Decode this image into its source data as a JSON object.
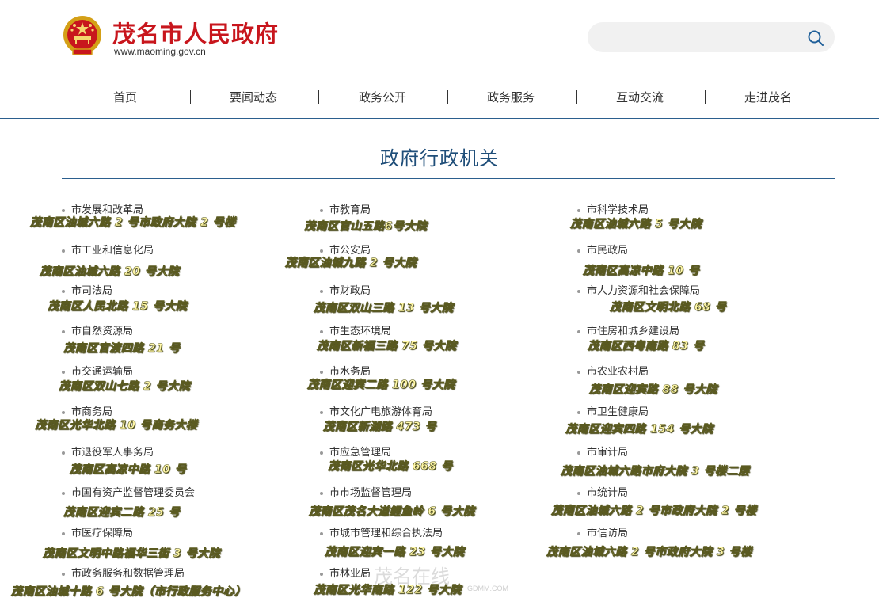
{
  "header": {
    "title": "茂名市人民政府",
    "url": "www.maoming.gov.cn",
    "search_placeholder": "",
    "brand_color": "#c8161d"
  },
  "nav": {
    "items": [
      "首页",
      "要闻动态",
      "政务公开",
      "政务服务",
      "互动交流",
      "走进茂名"
    ]
  },
  "section": {
    "title": "政府行政机关"
  },
  "agencies": {
    "col1": [
      {
        "name": "市发展和改革局",
        "address": "茂南区油城六路 2 号市政府大院 2 号楼"
      },
      {
        "name": "市工业和信息化局",
        "address": "茂南区油城六路 20 号大院"
      },
      {
        "name": "市司法局",
        "address": "茂南区人民北路 15 号大院"
      },
      {
        "name": "市自然资源局",
        "address": "茂南区官渡四路 21 号"
      },
      {
        "name": "市交通运输局",
        "address": "茂南区双山七路 2 号大院"
      },
      {
        "name": "市商务局",
        "address": "茂南区光华北路 10 号商务大楼"
      },
      {
        "name": "市退役军人事务局",
        "address": "茂南区高凉中路 10 号"
      },
      {
        "name": "市国有资产监督管理委员会",
        "address": "茂南区迎宾二路 25 号"
      },
      {
        "name": "市医疗保障局",
        "address": "茂南区文明中路福华三街 3 号大院"
      },
      {
        "name": "市政务服务和数据管理局",
        "address": "茂南区油城十路 6 号大院（市行政服务中心）"
      }
    ],
    "col2": [
      {
        "name": "市教育局",
        "address": "茂南区官山五路6号大院"
      },
      {
        "name": "市公安局",
        "address": "茂南区油城九路 2 号大院"
      },
      {
        "name": "市财政局",
        "address": "茂南区双山三路 13 号大院"
      },
      {
        "name": "市生态环境局",
        "address": "茂南区新福三路 75 号大院"
      },
      {
        "name": "市水务局",
        "address": "茂南区迎宾二路 100 号大院"
      },
      {
        "name": "市文化广电旅游体育局",
        "address": "茂南区新湖路 473 号"
      },
      {
        "name": "市应急管理局",
        "address": "茂南区光华北路 668 号"
      },
      {
        "name": "市市场监督管理局",
        "address": "茂南区茂名大道鲤鱼岭 6 号大院"
      },
      {
        "name": "市城市管理和综合执法局",
        "address": "茂南区迎宾一路 23 号大院"
      },
      {
        "name": "市林业局",
        "address": "茂南区光华南路 122 号大院"
      }
    ],
    "col3": [
      {
        "name": "市科学技术局",
        "address": "茂南区油城六路 5 号大院"
      },
      {
        "name": "市民政局",
        "address": "茂南区高凉中路 10 号"
      },
      {
        "name": "市人力资源和社会保障局",
        "address": "茂南区文明北路 68 号"
      },
      {
        "name": "市住房和城乡建设局",
        "address": "茂南区西粤南路 83 号"
      },
      {
        "name": "市农业农村局",
        "address": "茂南区迎宾路 88 号大院"
      },
      {
        "name": "市卫生健康局",
        "address": "茂南区迎宾四路 154 号大院"
      },
      {
        "name": "市审计局",
        "address": "茂南区油城六路市府大院 3 号楼二层"
      },
      {
        "name": "市统计局",
        "address": "茂南区油城六路 2 号市政府大院 2 号楼"
      },
      {
        "name": "市信访局",
        "address": "茂南区油城六路 2 号市政府大院 3 号楼"
      }
    ]
  },
  "watermark": {
    "text": "茂名在线",
    "sub": "GDMM.COM"
  }
}
